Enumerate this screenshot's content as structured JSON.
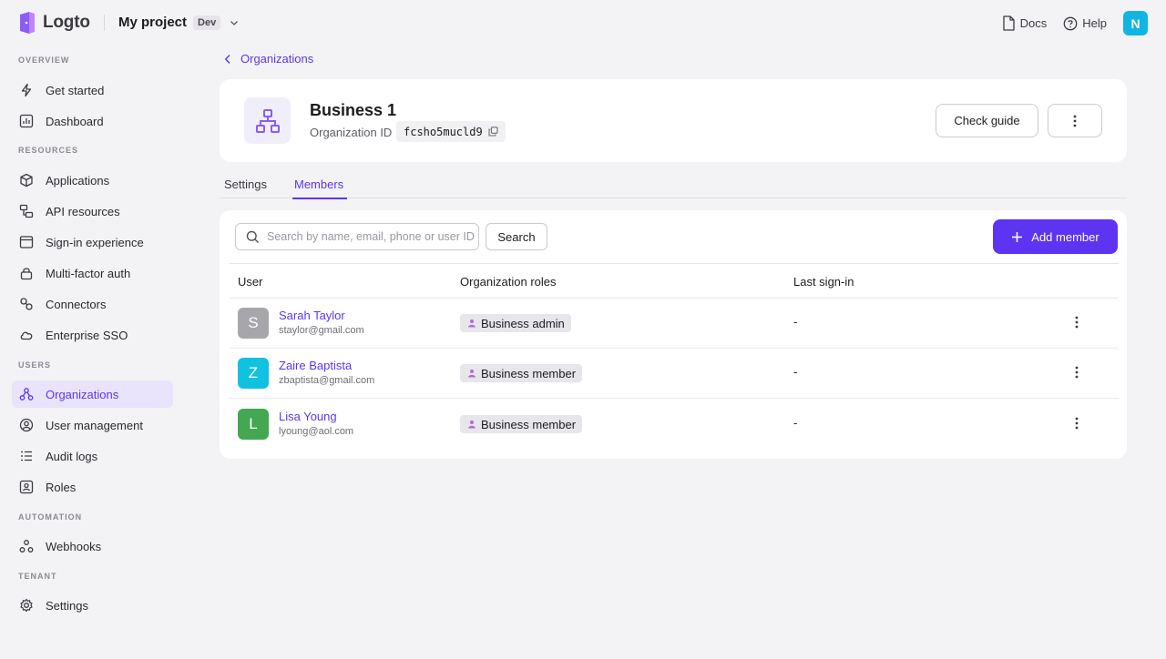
{
  "brand": {
    "name": "Logto"
  },
  "project": {
    "name": "My project",
    "env": "Dev"
  },
  "top_links": {
    "docs": "Docs",
    "help": "Help",
    "user_initial": "N"
  },
  "sidebar": {
    "sections": {
      "overview": "OVERVIEW",
      "resources": "RESOURCES",
      "users": "USERS",
      "automation": "AUTOMATION",
      "tenant": "TENANT"
    },
    "items": [
      {
        "label": "Get started",
        "icon": "bolt-icon"
      },
      {
        "label": "Dashboard",
        "icon": "chart-icon"
      },
      {
        "label": "Applications",
        "icon": "cube-icon"
      },
      {
        "label": "API resources",
        "icon": "api-icon"
      },
      {
        "label": "Sign-in experience",
        "icon": "window-icon"
      },
      {
        "label": "Multi-factor auth",
        "icon": "lock-icon"
      },
      {
        "label": "Connectors",
        "icon": "connector-icon"
      },
      {
        "label": "Enterprise SSO",
        "icon": "cloud-icon"
      },
      {
        "label": "Organizations",
        "icon": "org-icon",
        "active": true
      },
      {
        "label": "User management",
        "icon": "user-icon"
      },
      {
        "label": "Audit logs",
        "icon": "list-icon"
      },
      {
        "label": "Roles",
        "icon": "role-icon"
      },
      {
        "label": "Webhooks",
        "icon": "webhook-icon"
      },
      {
        "label": "Settings",
        "icon": "gear-icon"
      }
    ]
  },
  "breadcrumb": {
    "label": "Organizations"
  },
  "organization": {
    "name": "Business 1",
    "id_label": "Organization ID",
    "id": "fcsho5mucld9"
  },
  "actions": {
    "check_guide": "Check guide"
  },
  "tabs": [
    {
      "label": "Settings"
    },
    {
      "label": "Members",
      "active": true
    }
  ],
  "members": {
    "search_placeholder": "Search by name, email, phone or user ID",
    "search_button": "Search",
    "add_button": "Add member",
    "columns": [
      "User",
      "Organization roles",
      "Last sign-in"
    ],
    "rows": [
      {
        "initial": "S",
        "avatar_color": "#a7a7ab",
        "name": "Sarah Taylor",
        "email": "staylor@gmail.com",
        "role": "Business admin",
        "last_sign_in": "-"
      },
      {
        "initial": "Z",
        "avatar_color": "#10c2e0",
        "name": "Zaire Baptista",
        "email": "zbaptista@gmail.com",
        "role": "Business member",
        "last_sign_in": "-"
      },
      {
        "initial": "L",
        "avatar_color": "#44a752",
        "name": "Lisa Young",
        "email": "lyoung@aol.com",
        "role": "Business member",
        "last_sign_in": "-"
      }
    ]
  },
  "colors": {
    "accent": "#5d34f2",
    "background": "#f3f3f5"
  }
}
